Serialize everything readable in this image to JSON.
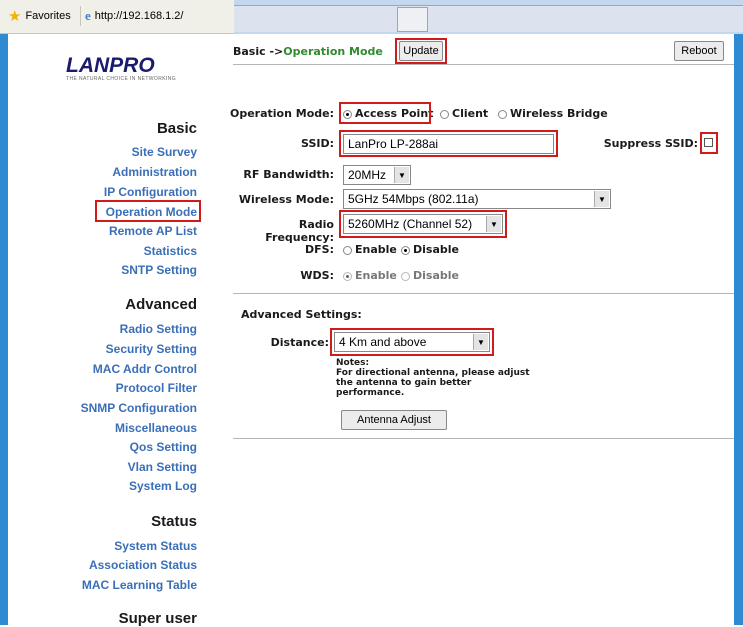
{
  "browser": {
    "favorites_label": "Favorites",
    "tab_url": "http://192.168.1.2/"
  },
  "logo": {
    "brand": "LANPRO",
    "tagline": "THE NATURAL CHOICE IN NETWORKING"
  },
  "sidebar": {
    "basic_title": "Basic",
    "basic_items": [
      "Site Survey",
      "Administration",
      "IP Configuration",
      "Operation Mode",
      "Remote AP List",
      "Statistics",
      "SNTP Setting"
    ],
    "advanced_title": "Advanced",
    "advanced_items": [
      "Radio Setting",
      "Security Setting",
      "MAC Addr Control",
      "Protocol Filter",
      "SNMP Configuration",
      "Miscellaneous",
      "Qos Setting",
      "Vlan Setting",
      "System Log"
    ],
    "status_title": "Status",
    "status_items": [
      "System Status",
      "Association Status",
      "MAC Learning Table"
    ],
    "superuser_title": "Super user"
  },
  "main": {
    "breadcrumb_prefix": "Basic ->",
    "breadcrumb_current": "Operation Mode",
    "update_label": "Update",
    "reboot_label": "Reboot",
    "operation_mode_label": "Operation Mode:",
    "mode_access_point": "Access Point",
    "mode_client": "Client",
    "mode_wireless_bridge": "Wireless Bridge",
    "ssid_label": "SSID:",
    "ssid_value": "LanPro LP-288ai",
    "suppress_ssid_label": "Suppress SSID:",
    "rf_bandwidth_label": "RF Bandwidth:",
    "rf_bandwidth_value": "20MHz",
    "wireless_mode_label": "Wireless Mode:",
    "wireless_mode_value": "5GHz 54Mbps (802.11a)",
    "radio_frequency_label": "Radio Frequency:",
    "radio_frequency_value": "5260MHz (Channel 52)",
    "dfs_label": "DFS:",
    "dfs_enable": "Enable",
    "dfs_disable": "Disable",
    "wds_label": "WDS:",
    "wds_enable": "Enable",
    "wds_disable": "Disable",
    "advanced_settings_label": "Advanced Settings:",
    "distance_label": "Distance:",
    "distance_value": "4 Km and above",
    "notes_title": "Notes:",
    "notes_line1": "For directional antenna, please adjust",
    "notes_line2": "the antenna to gain better",
    "notes_line3": "performance.",
    "antenna_adjust_label": "Antenna Adjust"
  },
  "colors": {
    "frame_blue": "#2f8bd1",
    "nav_blue": "#3a6fb8",
    "breadcrumb_green": "#2e8b2e",
    "highlight_red": "#d11a1a"
  }
}
